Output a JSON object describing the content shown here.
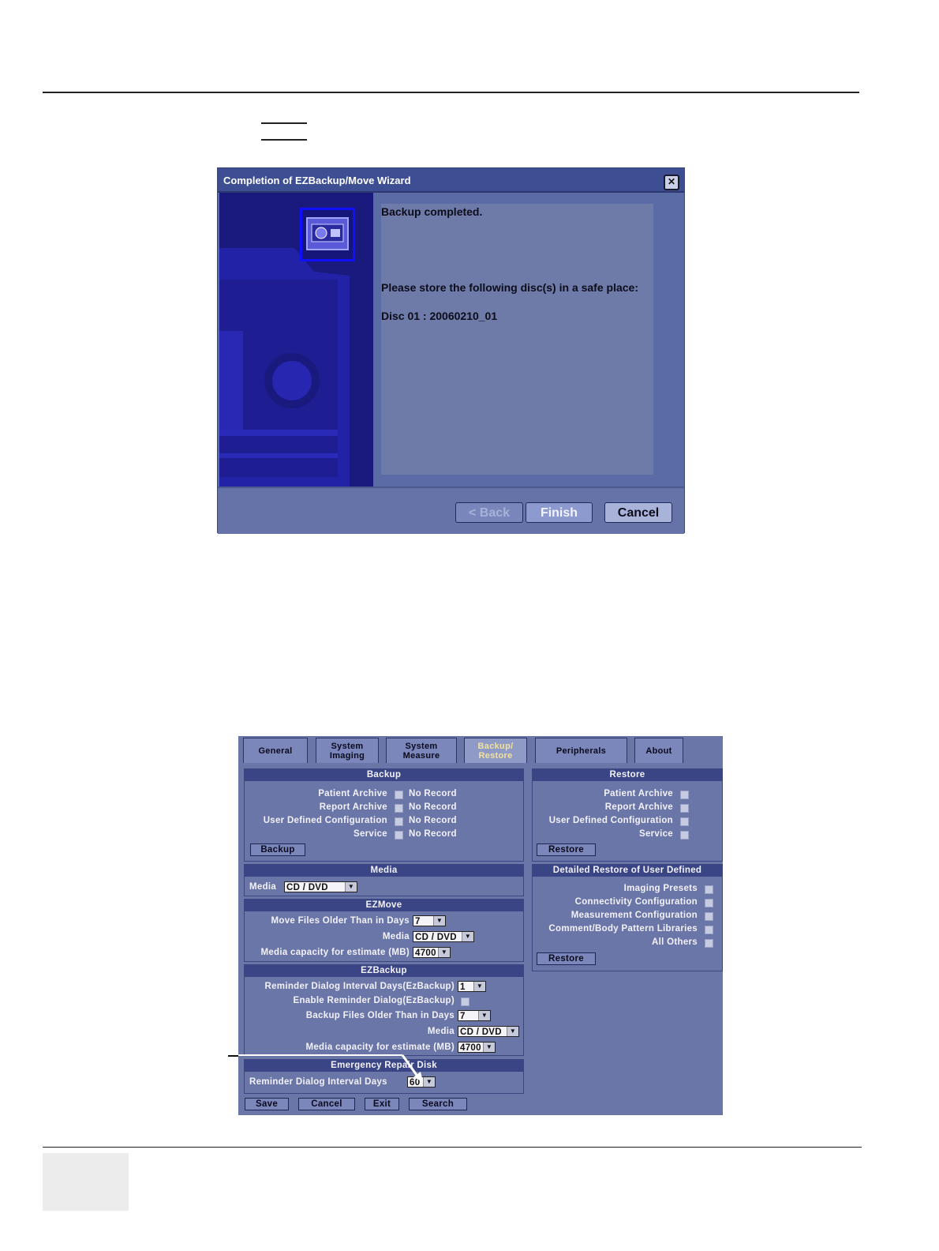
{
  "wizard": {
    "title": "Completion of EZBackup/Move Wizard",
    "message_completed": "Backup completed.",
    "message_store": "Please store the following disc(s) in a safe place:",
    "disc_label": "Disc 01 : 20060210_01",
    "back_label": "< Back",
    "finish_label": "Finish",
    "cancel_label": "Cancel"
  },
  "tabs": [
    {
      "line1": "General",
      "line2": ""
    },
    {
      "line1": "System",
      "line2": "Imaging"
    },
    {
      "line1": "System",
      "line2": "Measure"
    },
    {
      "line1": "Backup/",
      "line2": "Restore"
    },
    {
      "line1": "Peripherals",
      "line2": ""
    },
    {
      "line1": "About",
      "line2": ""
    }
  ],
  "backup": {
    "header": "Backup",
    "items": [
      {
        "label": "Patient Archive",
        "status": "No Record"
      },
      {
        "label": "Report Archive",
        "status": "No Record"
      },
      {
        "label": "User Defined Configuration",
        "status": "No Record"
      },
      {
        "label": "Service",
        "status": "No Record"
      }
    ],
    "button": "Backup"
  },
  "restore": {
    "header": "Restore",
    "items": [
      "Patient Archive",
      "Report Archive",
      "User Defined Configuration",
      "Service"
    ],
    "button": "Restore"
  },
  "media": {
    "header": "Media",
    "label": "Media",
    "value": "CD / DVD"
  },
  "detailed_restore": {
    "header": "Detailed Restore of User Defined",
    "items": [
      "Imaging Presets",
      "Connectivity Configuration",
      "Measurement Configuration",
      "Comment/Body Pattern Libraries",
      "All Others"
    ],
    "button": "Restore"
  },
  "ezmove": {
    "header": "EZMove",
    "days_label": "Move Files Older Than in Days",
    "days_value": "7",
    "media_label": "Media",
    "media_value": "CD / DVD",
    "capacity_label": "Media capacity for estimate (MB)",
    "capacity_value": "4700"
  },
  "ezbackup": {
    "header": "EZBackup",
    "reminder_label": "Reminder Dialog Interval Days(EzBackup)",
    "reminder_value": "1",
    "enable_label": "Enable Reminder Dialog(EzBackup)",
    "days_label": "Backup Files Older Than in Days",
    "days_value": "7",
    "media_label": "Media",
    "media_value": "CD / DVD",
    "capacity_label": "Media capacity for estimate (MB)",
    "capacity_value": "4700"
  },
  "emergency": {
    "header": "Emergency Repair Disk",
    "reminder_label": "Reminder Dialog Interval Days",
    "reminder_value": "60"
  },
  "bottom_buttons": {
    "save": "Save",
    "cancel": "Cancel",
    "exit": "Exit",
    "search": "Search"
  }
}
